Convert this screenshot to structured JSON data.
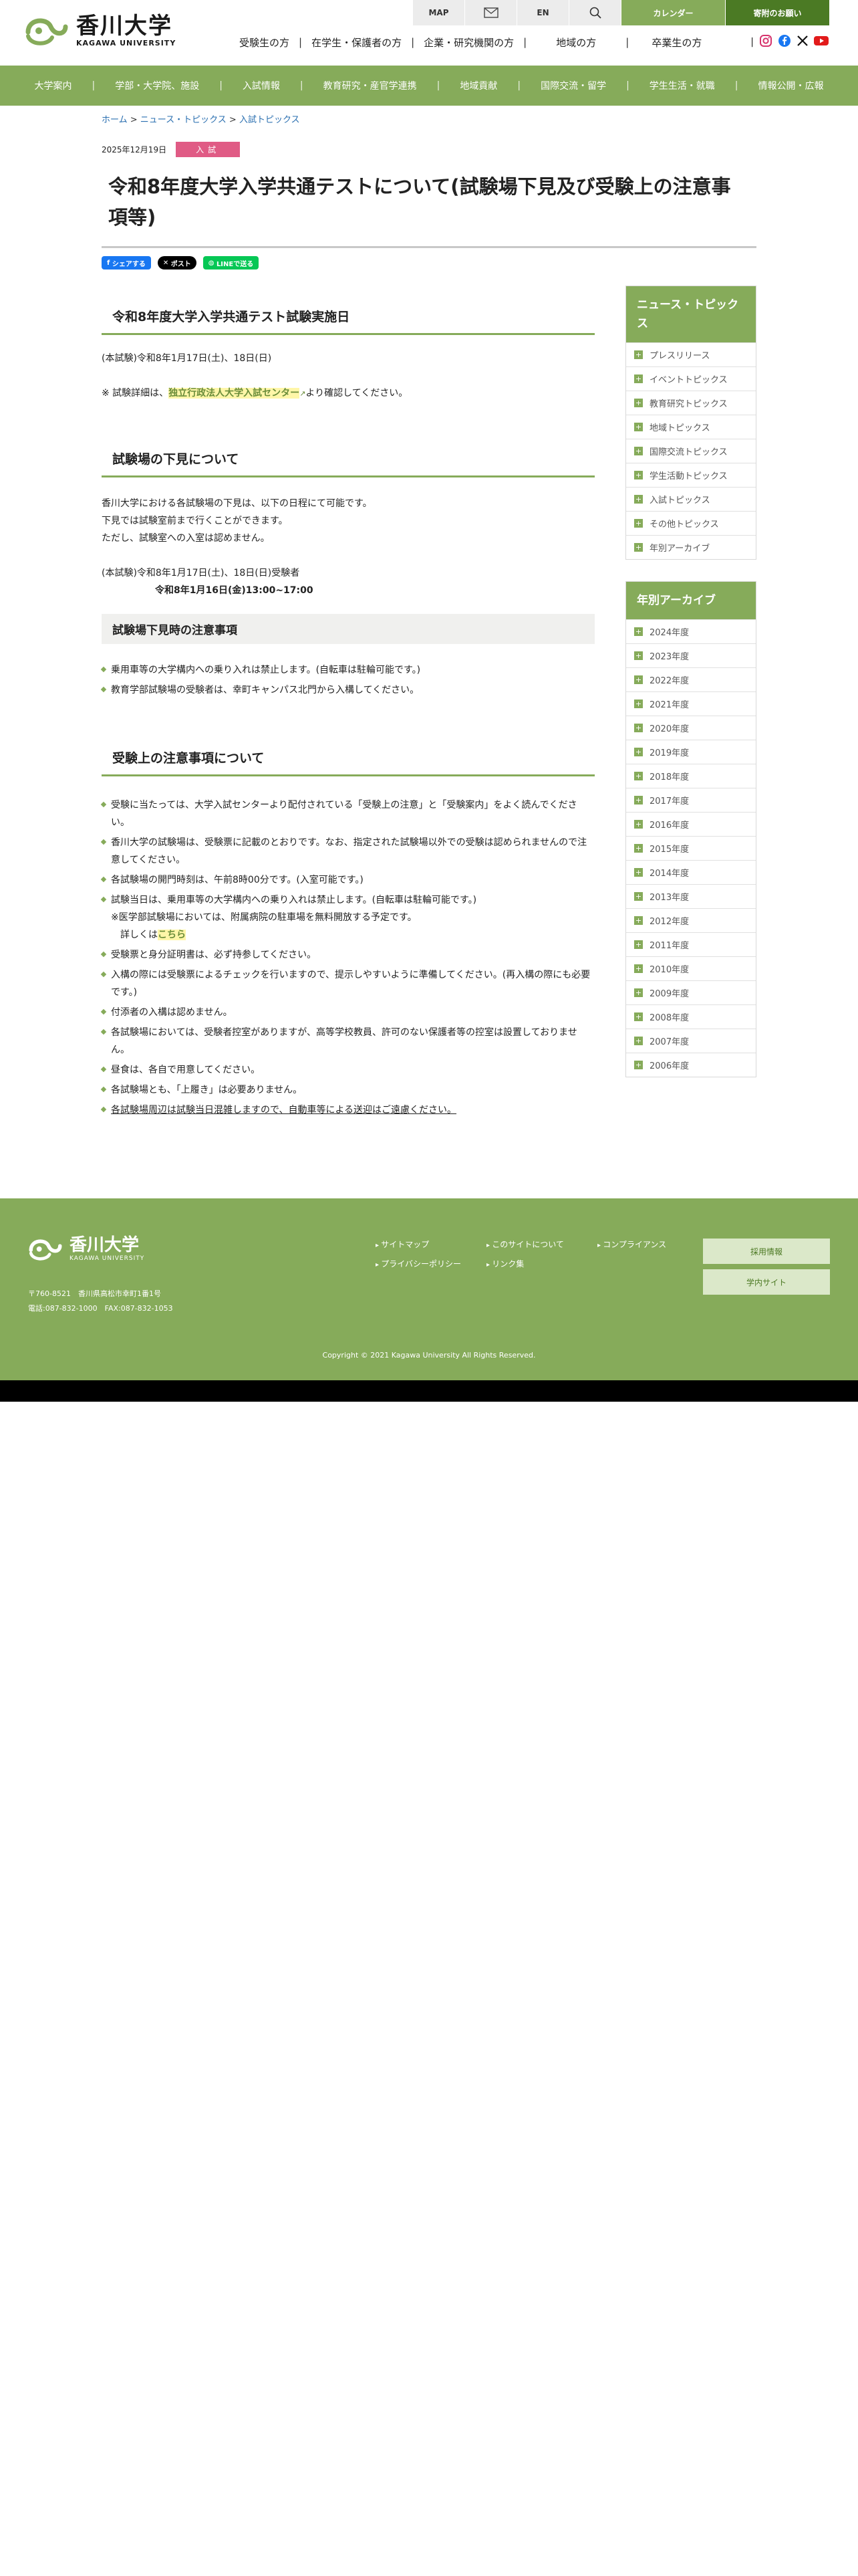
{
  "header": {
    "logo_jp": "香川大学",
    "logo_en": "KAGAWA UNIVERSITY",
    "util": {
      "map": "MAP",
      "lang": "EN",
      "calendar": "カレンダー",
      "donation": "寄附のお願い"
    },
    "audience": [
      "受験生の方",
      "在学生・保護者の方",
      "企業・研究機関の方",
      "地域の方",
      "卒業生の方"
    ]
  },
  "gnav": [
    "大学案内",
    "学部・大学院、施設",
    "入試情報",
    "教育研究・産官学連携",
    "地域貢献",
    "国際交流・留学",
    "学生生活・就職",
    "情報公開・広報"
  ],
  "breadcrumb": {
    "home": "ホーム",
    "news": "ニュース・トピックス",
    "current": "入試トピックス"
  },
  "article": {
    "date": "2025年12月19日",
    "tag": "入試",
    "title": "令和8年度大学入学共通テストについて(試験場下見及び受験上の注意事項等)",
    "share": {
      "fb": "シェアする",
      "x": "ポスト",
      "line": "LINEで送る"
    },
    "s1": {
      "heading": "令和8年度大学入学共通テスト試験実施日",
      "date": "(本試験)令和8年1月17日(土)、18日(日)",
      "note_pre": "※ 試験詳細は、",
      "note_link": "独立行政法人大学入試センター",
      "note_post": "より確認してください。"
    },
    "s2": {
      "heading": "試験場の下見について",
      "lines": [
        "香川大学における各試験場の下見は、以下の日程にて可能です。",
        "下見では試験室前まで行くことができます。",
        "ただし、試験室への入室は認めません。"
      ],
      "date_line": "(本試験)令和8年1月17日(土)、18日(日)受験者",
      "time_line": "令和8年1月16日(金)13:00~17:00"
    },
    "s3": {
      "heading": "試験場下見時の注意事項",
      "items": [
        "乗用車等の大学構内への乗り入れは禁止します。(自転車は駐輪可能です。)",
        "教育学部試験場の受験者は、幸町キャンパス北門から入構してください。"
      ]
    },
    "s4": {
      "heading": "受験上の注意事項について",
      "items": [
        "受験に当たっては、大学入試センターより配付されている「受験上の注意」と「受験案内」をよく読んでください。",
        "香川大学の試験場は、受験票に記載のとおりです。なお、指定された試験場以外での受験は認められませんので注意してください。",
        "各試験場の開門時刻は、午前8時00分です。(入室可能です。)",
        "試験当日は、乗用車等の大学構内への乗り入れは禁止します。(自転車は駐輪可能です。)",
        "受験票と身分証明書は、必ず持参してください。",
        "入構の際には受験票によるチェックを行いますので、提示しやすいように準備してください。(再入構の際にも必要です。)",
        "付添者の入構は認めません。",
        "各試験場においては、受験者控室がありますが、高等学校教員、許可のない保護者等の控室は設置しておりません。",
        "昼食は、各自で用意してください。",
        "各試験場とも、「上履き」は必要ありません。",
        "各試験場周辺は試験当日混雑しますので、自動車等による送迎はご遠慮ください。"
      ],
      "sub1": "※医学部試験場においては、附属病院の駐車場を無料開放する予定です。",
      "sub2_pre": "詳しくは",
      "sub2_link": "こちら"
    }
  },
  "sidebar": {
    "news_title": "ニュース・トピックス",
    "news_items": [
      "プレスリリース",
      "イベントトピックス",
      "教育研究トピックス",
      "地域トピックス",
      "国際交流トピックス",
      "学生活動トピックス",
      "入試トピックス",
      "その他トピックス",
      "年別アーカイブ"
    ],
    "archive_title": "年別アーカイブ",
    "archive_items": [
      "2024年度",
      "2023年度",
      "2022年度",
      "2021年度",
      "2020年度",
      "2019年度",
      "2018年度",
      "2017年度",
      "2016年度",
      "2015年度",
      "2014年度",
      "2013年度",
      "2012年度",
      "2011年度",
      "2010年度",
      "2009年度",
      "2008年度",
      "2007年度",
      "2006年度"
    ]
  },
  "footer": {
    "logo_jp": "香川大学",
    "logo_en": "KAGAWA UNIVERSITY",
    "address": "〒760-8521　香川県高松市幸町1番1号",
    "tel": "電話:087-832-1000　FAX:087-832-1053",
    "links": [
      "サイトマップ",
      "このサイトについて",
      "コンプライアンス",
      "プライバシーポリシー",
      "リンク集"
    ],
    "btn_recruit": "採用情報",
    "btn_campus": "学内サイト",
    "copyright": "Copyright © 2021 Kagawa University All Rights Reserved."
  },
  "colors": {
    "green": "#86ab5a",
    "dark_green": "#4b7a24",
    "tag_pink": "#e05b85"
  }
}
